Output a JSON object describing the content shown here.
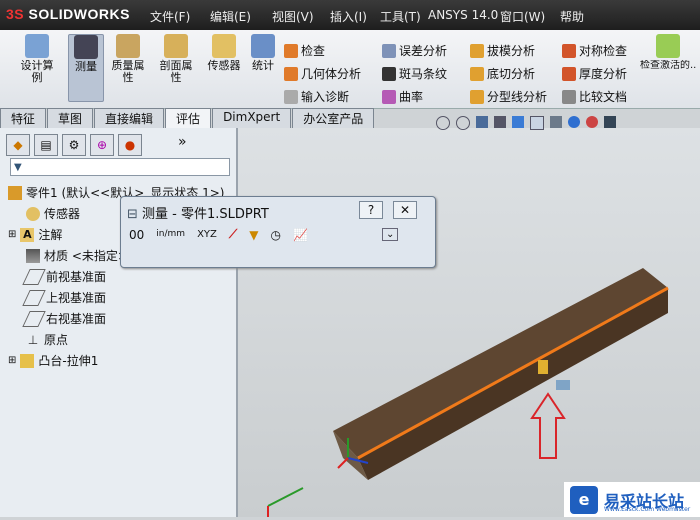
{
  "app": {
    "logo": "SOLIDWORKS",
    "logo_prefix": "3S"
  },
  "menubar": {
    "items": [
      "文件(F)",
      "编辑(E)",
      "视图(V)",
      "插入(I)",
      "工具(T)",
      "ANSYS 14.0",
      "窗口(W)",
      "帮助"
    ]
  },
  "ribbon": {
    "large_buttons": [
      {
        "label": "设计算\n例",
        "icon": "design-study-icon"
      },
      {
        "label": "测量",
        "icon": "measure-icon",
        "active": true
      },
      {
        "label": "质量属\n性",
        "icon": "mass-properties-icon"
      },
      {
        "label": "剖面属\n性",
        "icon": "section-properties-icon"
      },
      {
        "label": "传感器",
        "icon": "sensor-icon"
      },
      {
        "label": "统计",
        "icon": "statistics-icon"
      }
    ],
    "small_col1": [
      "检查",
      "几何体分析",
      "输入诊断"
    ],
    "small_col2": [
      "误差分析",
      "斑马条纹",
      "曲率"
    ],
    "small_col3": [
      "拔模分析",
      "底切分析",
      "分型线分析"
    ],
    "small_col4": [
      "对称检查",
      "厚度分析",
      "比较文档"
    ],
    "extra": "检查激活的..."
  },
  "tabs": [
    "特征",
    "草图",
    "直接编辑",
    "评估",
    "DimXpert",
    "办公室产品"
  ],
  "active_tab": "评估",
  "tree": {
    "items": [
      {
        "label": "零件1 (默认<<默认>_显示状态 1>)",
        "icon": "part-icon"
      },
      {
        "label": "传感器",
        "icon": "sensor-icon"
      },
      {
        "label": "注解",
        "icon": "annotation-icon"
      },
      {
        "label": "材质 <未指定>",
        "icon": "material-icon"
      },
      {
        "label": "前视基准面",
        "icon": "plane-icon"
      },
      {
        "label": "上视基准面",
        "icon": "plane-icon"
      },
      {
        "label": "右视基准面",
        "icon": "plane-icon"
      },
      {
        "label": "原点",
        "icon": "origin-icon"
      },
      {
        "label": "凸台-拉伸1",
        "icon": "extrude-icon"
      }
    ]
  },
  "dialog": {
    "title": "测量 - 零件1.SLDPRT",
    "help": "?",
    "close": "✕",
    "tools": [
      "00",
      "in/mm",
      "XYZ",
      "⟋",
      "▼",
      "◷",
      "📈"
    ]
  },
  "watermark": {
    "text": "易采站长站",
    "sub": "Www.Easck.Com Webmaster",
    "icon_letter": "e"
  },
  "colors": {
    "menubar": "#2a2a2a",
    "accent": "#1f5fbf",
    "arrow": "#d9252a",
    "beam_edge": "#f07a1a"
  }
}
